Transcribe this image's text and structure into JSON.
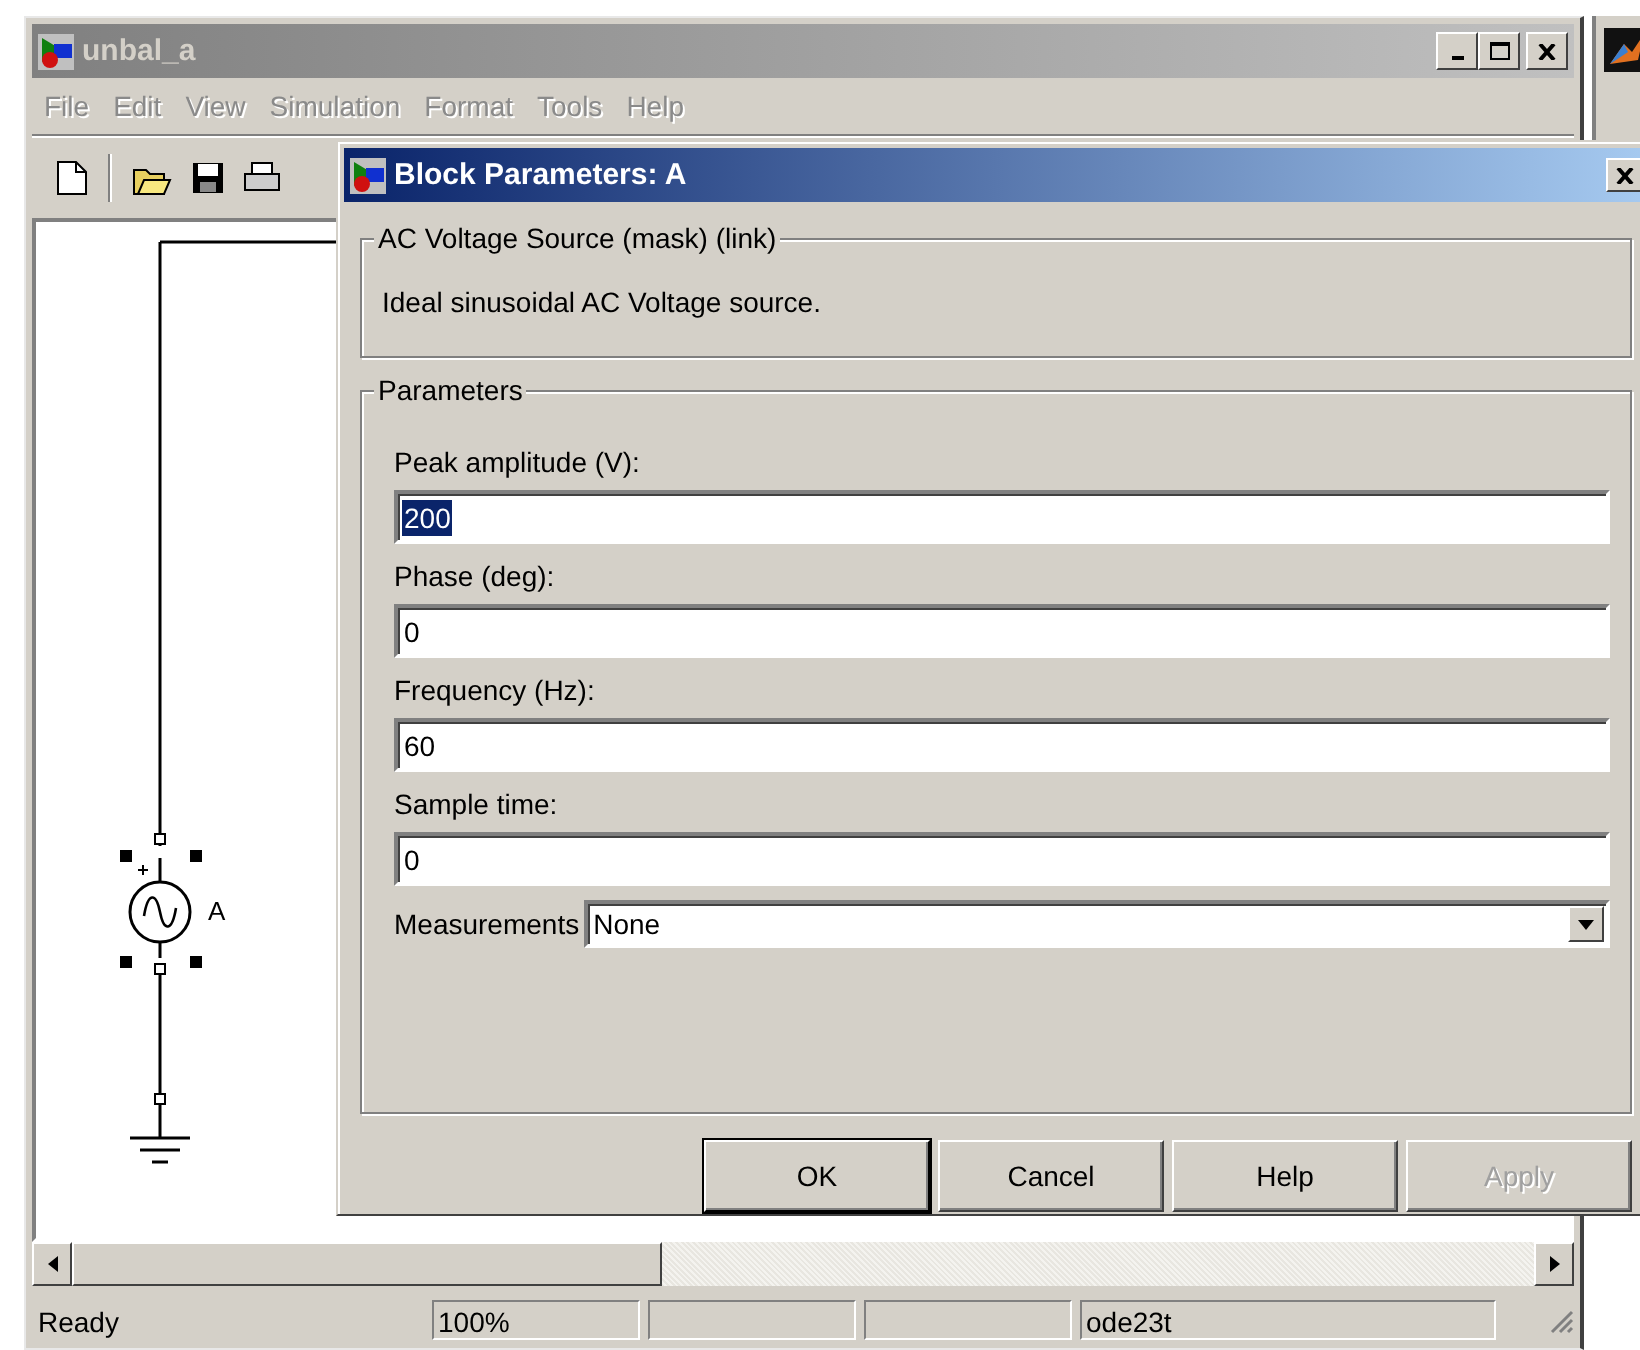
{
  "main_window": {
    "title": "unbal_a",
    "menu": [
      {
        "label": "File",
        "disabled": true
      },
      {
        "label": "Edit",
        "disabled": true
      },
      {
        "label": "View",
        "disabled": true
      },
      {
        "label": "Simulation",
        "disabled": true
      },
      {
        "label": "Format",
        "disabled": true
      },
      {
        "label": "Tools",
        "disabled": true
      },
      {
        "label": "Help",
        "disabled": true
      }
    ],
    "diagram": {
      "block_label": "A",
      "block_selected": true
    },
    "status_bar": {
      "status": "Ready",
      "zoom": "100%",
      "solver": "ode23t"
    }
  },
  "dialog": {
    "title": "Block Parameters: A",
    "description_group": {
      "title": "AC Voltage Source (mask) (link)",
      "text": "Ideal sinusoidal AC Voltage source."
    },
    "parameters_group": {
      "title": "Parameters",
      "fields": [
        {
          "label": "Peak amplitude (V):",
          "value": "200",
          "selected": true
        },
        {
          "label": "Phase (deg):",
          "value": "0",
          "selected": false
        },
        {
          "label": "Frequency (Hz):",
          "value": "60",
          "selected": false
        },
        {
          "label": "Sample time:",
          "value": "0",
          "selected": false
        }
      ],
      "measurements": {
        "label": "Measurements",
        "value": "None"
      }
    },
    "buttons": [
      {
        "label": "OK",
        "default": true,
        "disabled": false
      },
      {
        "label": "Cancel",
        "default": false,
        "disabled": false
      },
      {
        "label": "Help",
        "default": false,
        "disabled": false
      },
      {
        "label": "Apply",
        "default": false,
        "disabled": true
      }
    ]
  }
}
